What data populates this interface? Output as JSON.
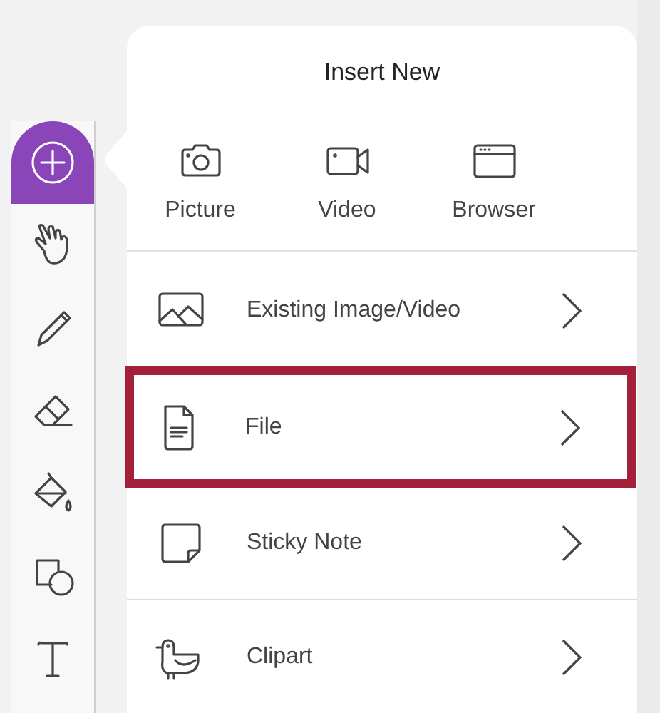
{
  "toolbar": {
    "tools": [
      {
        "kind": "insert",
        "selected": true
      },
      {
        "kind": "hand",
        "selected": false
      },
      {
        "kind": "pencil",
        "selected": false
      },
      {
        "kind": "eraser",
        "selected": false
      },
      {
        "kind": "fill",
        "selected": false
      },
      {
        "kind": "shapes",
        "selected": false
      },
      {
        "kind": "text",
        "selected": false
      }
    ]
  },
  "popover": {
    "title": "Insert New",
    "quick_items": [
      {
        "kind": "camera",
        "label": "Picture"
      },
      {
        "kind": "video",
        "label": "Video"
      },
      {
        "kind": "browser",
        "label": "Browser"
      }
    ],
    "rows": [
      {
        "kind": "image",
        "label": "Existing Image/Video",
        "highlighted": false,
        "divider": false
      },
      {
        "kind": "file",
        "label": "File",
        "highlighted": true,
        "divider": false
      },
      {
        "kind": "note",
        "label": "Sticky Note",
        "highlighted": false,
        "divider": true
      },
      {
        "kind": "bird",
        "label": "Clipart",
        "highlighted": false,
        "divider": false
      }
    ]
  }
}
